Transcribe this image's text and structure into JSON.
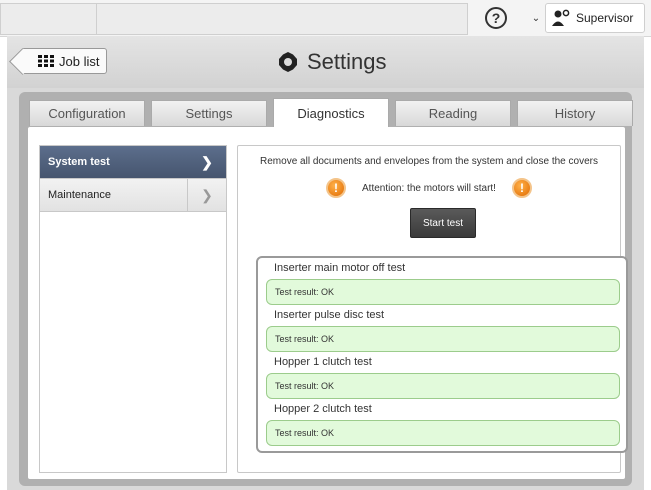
{
  "topbar": {
    "help_label": "?",
    "user_name": "Supervisor"
  },
  "header": {
    "job_list_label": "Job list",
    "title": "Settings"
  },
  "tabs": [
    {
      "label": "Configuration"
    },
    {
      "label": "Settings"
    },
    {
      "label": "Diagnostics",
      "active": true
    },
    {
      "label": "Reading"
    },
    {
      "label": "History"
    }
  ],
  "sidebar": {
    "items": [
      {
        "label": "System test",
        "active": true
      },
      {
        "label": "Maintenance"
      }
    ]
  },
  "main": {
    "instruction": "Remove all documents and envelopes from the system and close the covers",
    "attention": "Attention: the motors will start!",
    "start_label": "Start test",
    "tests": [
      {
        "name": "Inserter main motor off test",
        "result": "Test result: OK"
      },
      {
        "name": "Inserter pulse disc test",
        "result": "Test result: OK"
      },
      {
        "name": "Hopper 1 clutch test",
        "result": "Test result: OK"
      },
      {
        "name": "Hopper 2 clutch test",
        "result": "Test result: OK"
      }
    ]
  },
  "colors": {
    "active_sidebar": "#4f5f7a",
    "warning": "#f08c1a",
    "result_bg": "#e2fadb"
  }
}
